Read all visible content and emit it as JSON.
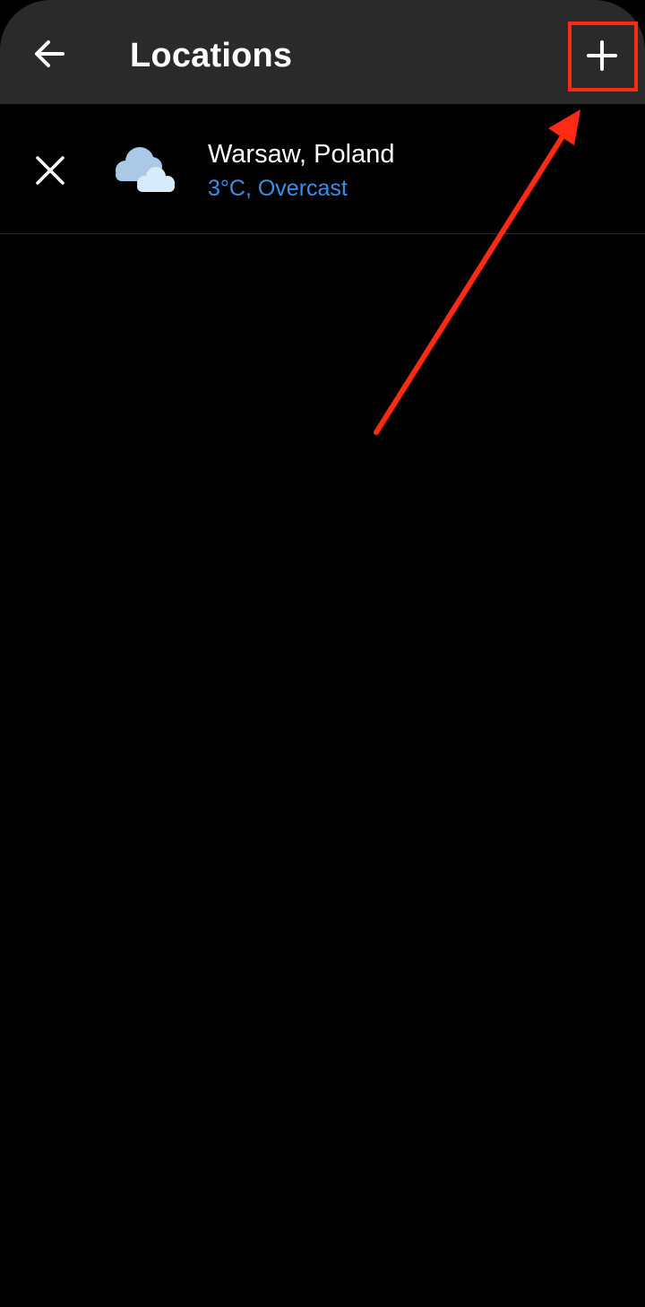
{
  "header": {
    "title": "Locations",
    "back_icon": "arrow-left-icon",
    "add_icon": "plus-icon"
  },
  "locations": [
    {
      "name": "Warsaw, Poland",
      "weather": "3°C, Overcast",
      "icon": "cloud-icon",
      "remove_icon": "close-icon"
    }
  ],
  "colors": {
    "background": "#000000",
    "app_bar": "#2a2a2a",
    "accent_text": "#3b8ee6",
    "annotation": "#ff2a14"
  }
}
